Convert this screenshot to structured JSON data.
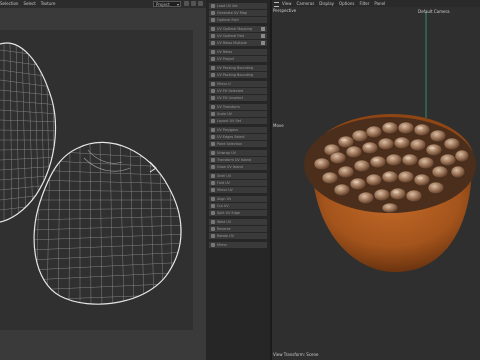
{
  "uv_editor": {
    "menus": [
      "Selection",
      "Select",
      "Texture"
    ],
    "projection_select": "Project"
  },
  "panel": {
    "items": [
      {
        "label": "Load UV Set"
      },
      {
        "label": "Generate UV Map"
      },
      {
        "label": "Optimal Fold"
      },
      {
        "label": "UV Optimal Mapping",
        "check": true
      },
      {
        "label": "UV Optimal Fold",
        "check": true
      },
      {
        "label": "UV Relax Multiple",
        "check": true
      },
      {
        "label": "UV Relax"
      },
      {
        "label": "UV Project"
      },
      {
        "label": "UV Packing Bounding"
      },
      {
        "label": "UV Packing Bounding"
      },
      {
        "label": "Mirror U"
      },
      {
        "label": "UV Fill Selected"
      },
      {
        "label": "UV Fill Unselect"
      },
      {
        "label": "UV Transform"
      },
      {
        "label": "Scale UV"
      },
      {
        "label": "Layout UV Set"
      },
      {
        "label": "UV Polygons"
      },
      {
        "label": "UV Edges Select"
      },
      {
        "label": "Paint Selection"
      },
      {
        "label": "Unwrap UV"
      },
      {
        "label": "Transform UV Island"
      },
      {
        "label": "Grow UV Island"
      },
      {
        "label": "Shell UV"
      },
      {
        "label": "Fold UV"
      },
      {
        "label": "Mirror UV"
      },
      {
        "label": "Align UV"
      },
      {
        "label": "Cut UV"
      },
      {
        "label": "Split UV Edge"
      },
      {
        "label": "Weld UV"
      },
      {
        "label": "Reverse"
      },
      {
        "label": "Rotate UV"
      },
      {
        "label": "Mirror"
      }
    ]
  },
  "viewport": {
    "menus": [
      "View",
      "Cameras",
      "Display",
      "Options",
      "Filter",
      "Panel"
    ],
    "view_name": "Perspective",
    "camera_name": "Default Camera",
    "tool_hint": "Move",
    "status": "View Transform: Scene"
  },
  "colors": {
    "bowl": "#a4541c",
    "bowl_dark": "#6e3510",
    "camera_line": "#2f8f6a",
    "wireframe": "#d8d8d8"
  }
}
